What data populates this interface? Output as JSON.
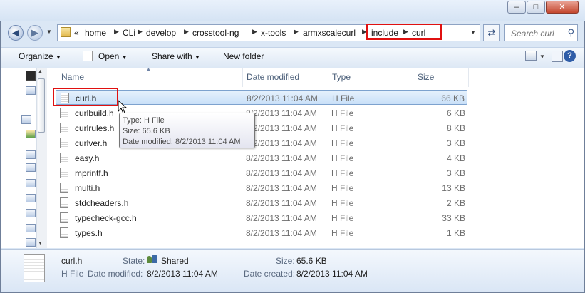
{
  "window": {
    "caption_buttons": {
      "minimize": "–",
      "maximize": "□",
      "close": "✕"
    }
  },
  "address": {
    "breadcrumbs": [
      "home",
      "CLi",
      "develop",
      "crosstool-ng",
      "x-tools",
      "armxscalecurl",
      "include",
      "curl"
    ],
    "overflow": "«"
  },
  "search": {
    "placeholder": "Search curl"
  },
  "toolbar": {
    "organize": "Organize",
    "open": "Open",
    "share_with": "Share with",
    "new_folder": "New folder"
  },
  "columns": {
    "name": "Name",
    "date_modified": "Date modified",
    "type": "Type",
    "size": "Size"
  },
  "files": [
    {
      "name": "curl.h",
      "date": "8/2/2013 11:04 AM",
      "type": "H File",
      "size": "66 KB",
      "selected": true
    },
    {
      "name": "curlbuild.h",
      "date": "8/2/2013 11:04 AM",
      "type": "H File",
      "size": "6 KB"
    },
    {
      "name": "curlrules.h",
      "date": "8/2/2013 11:04 AM",
      "type": "H File",
      "size": "8 KB"
    },
    {
      "name": "curlver.h",
      "date": "8/2/2013 11:04 AM",
      "type": "H File",
      "size": "3 KB"
    },
    {
      "name": "easy.h",
      "date": "8/2/2013 11:04 AM",
      "type": "H File",
      "size": "4 KB"
    },
    {
      "name": "mprintf.h",
      "date": "8/2/2013 11:04 AM",
      "type": "H File",
      "size": "3 KB"
    },
    {
      "name": "multi.h",
      "date": "8/2/2013 11:04 AM",
      "type": "H File",
      "size": "13 KB"
    },
    {
      "name": "stdcheaders.h",
      "date": "8/2/2013 11:04 AM",
      "type": "H File",
      "size": "2 KB"
    },
    {
      "name": "typecheck-gcc.h",
      "date": "8/2/2013 11:04 AM",
      "type": "H File",
      "size": "33 KB"
    },
    {
      "name": "types.h",
      "date": "8/2/2013 11:04 AM",
      "type": "H File",
      "size": "1 KB"
    }
  ],
  "tooltip": {
    "type": "Type: H File",
    "size": "Size: 65.6 KB",
    "date": "Date modified: 8/2/2013 11:04 AM"
  },
  "details": {
    "name": "curl.h",
    "type": "H File",
    "state_label": "State:",
    "state_value": "Shared",
    "size_label": "Size:",
    "size_value": "65.6 KB",
    "modified_label": "Date modified:",
    "modified_value": "8/2/2013 11:04 AM",
    "created_label": "Date created:",
    "created_value": "8/2/2013 11:04 AM"
  },
  "annotation_color": "#e01010",
  "selection_color": "#c9e0f8"
}
